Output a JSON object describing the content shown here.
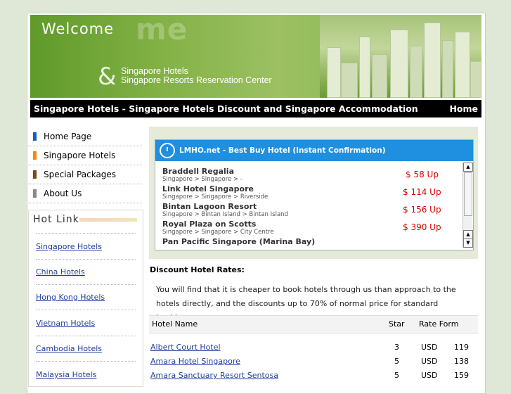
{
  "banner": {
    "welcome": "Welcome",
    "ghost": "me",
    "ampersand": "&",
    "tagline1": "Singapore Hotels",
    "tagline2": "Singapore Resorts Reservation Center"
  },
  "titlebar": {
    "title": "Singapore Hotels - Singapore Hotels Discount and Singapore Accommodation",
    "home": "Home"
  },
  "nav": {
    "items": [
      {
        "label": "Home Page",
        "color": "#1a5fb4"
      },
      {
        "label": "Singapore Hotels",
        "color": "#f08c00"
      },
      {
        "label": "Special Packages",
        "color": "#7a4a10"
      },
      {
        "label": "About Us",
        "color": "#888888"
      }
    ]
  },
  "hotlink": {
    "heading": "Hot Link",
    "links": [
      "Singapore Hotels",
      "China Hotels",
      "Hong Kong Hotels",
      "Vietnam Hotels",
      "Cambodia Hotels",
      "Malaysia Hotels"
    ]
  },
  "widget": {
    "title": "LMHO.net - Best Buy Hotel (Instant Confirmation)",
    "hotels": [
      {
        "name": "Braddell Regalia",
        "location": "Singapore > Singapore > -",
        "price": "$ 58 Up"
      },
      {
        "name": "Link Hotel Singapore",
        "location": "Singapore > Singapore > Riverside",
        "price": "$ 114 Up"
      },
      {
        "name": "Bintan Lagoon Resort",
        "location": "Singapore > Bintan Island > Bintan Island",
        "price": "$ 156 Up"
      },
      {
        "name": "Royal Plaza on Scotts",
        "location": "Singapore > Singapore > City Centre",
        "price": "$ 390 Up"
      },
      {
        "name": "Pan Pacific Singapore (Marina Bay)",
        "location": "",
        "price": ""
      }
    ]
  },
  "discount": {
    "heading": "Discount Hotel Rates:",
    "text": "You will find that it is cheaper to book hotels through us than approach to the hotels directly, and the discounts up to 70% of normal price for standard bookings."
  },
  "table": {
    "headers": {
      "name": "Hotel Name",
      "star": "Star",
      "rate": "Rate Form"
    },
    "rows": [
      {
        "name": "Albert Court Hotel",
        "star": "3",
        "currency": "USD",
        "rate": "119"
      },
      {
        "name": "Amara Hotel Singapore",
        "star": "5",
        "currency": "USD",
        "rate": "138"
      },
      {
        "name": "Amara Sanctuary Resort Sentosa",
        "star": "5",
        "currency": "USD",
        "rate": "159"
      }
    ]
  }
}
